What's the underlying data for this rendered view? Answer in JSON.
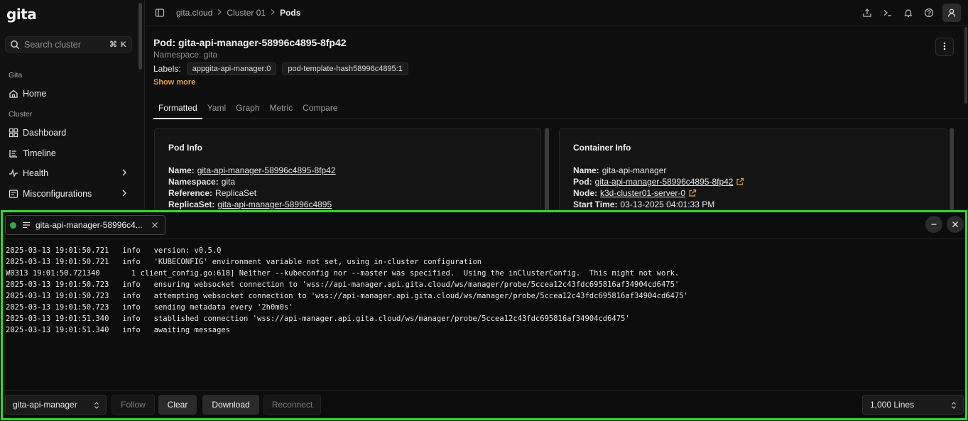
{
  "app": {
    "logo": "gita"
  },
  "sidebar": {
    "search_placeholder": "Search cluster",
    "search_shortcut": "⌘ K",
    "sections": [
      {
        "label": "Gita"
      },
      {
        "label": "Cluster"
      }
    ],
    "items": [
      {
        "label": "Home",
        "icon": "home-icon"
      },
      {
        "label": "Dashboard",
        "icon": "grid-icon"
      },
      {
        "label": "Timeline",
        "icon": "timeline-icon"
      },
      {
        "label": "Health",
        "icon": "pulse-icon"
      },
      {
        "label": "Misconfigurations",
        "icon": "config-icon"
      }
    ]
  },
  "breadcrumb": [
    "gita.cloud",
    "Cluster 01",
    "Pods"
  ],
  "pod": {
    "title": "Pod: gita-api-manager-58996c4895-8fp42",
    "namespace": "Namespace: gita",
    "labels_label": "Labels:",
    "labels": [
      "appgita-api-manager:0",
      "pod-template-hash58996c4895:1"
    ],
    "show_more": "Show more"
  },
  "tabs": [
    "Formatted",
    "Yaml",
    "Graph",
    "Metric",
    "Compare"
  ],
  "pod_info": {
    "title": "Pod Info",
    "rows": [
      {
        "k": "Name:",
        "v": "gita-api-manager-58996c4895-8fp42"
      },
      {
        "k": "Namespace:",
        "v": "gita"
      },
      {
        "k": "Reference:",
        "v": "ReplicaSet"
      },
      {
        "k": "ReplicaSet:",
        "v": "gita-api-manager-58996c4895"
      }
    ]
  },
  "container_info": {
    "title": "Container Info",
    "rows": [
      {
        "k": "Name:",
        "v": "gita-api-manager"
      },
      {
        "k": "Pod:",
        "v": "gita-api-manager-58996c4895-8fp42"
      },
      {
        "k": "Node:",
        "v": "k3d-cluster01-server-0"
      },
      {
        "k": "Start Time:",
        "v": "03-13-2025 04:01:33 PM"
      }
    ]
  },
  "logs": {
    "tab_title": "gita-api-manager-58996c4...",
    "lines": [
      "2025-03-13 19:01:50.721   info   version: v0.5.0",
      "2025-03-13 19:01:50.721   info   'KUBECONFIG' environment variable not set, using in-cluster configuration",
      "W0313 19:01:50.721340       1 client_config.go:618] Neither --kubeconfig nor --master was specified.  Using the inClusterConfig.  This might not work.",
      "2025-03-13 19:01:50.723   info   ensuring websocket connection to 'wss://api-manager.api.gita.cloud/ws/manager/probe/5ccea12c43fdc695816af34904cd6475'",
      "2025-03-13 19:01:50.723   info   attempting websocket connection to 'wss://api-manager.api.gita.cloud/ws/manager/probe/5ccea12c43fdc695816af34904cd6475'",
      "2025-03-13 19:01:50.723   info   sending metadata every '2h0m0s'",
      "2025-03-13 19:01:51.340   info   stablished connection 'wss://api-manager.api.gita.cloud/ws/manager/probe/5ccea12c43fdc695816af34904cd6475'",
      "2025-03-13 19:01:51.340   info   awaiting messages"
    ],
    "container_select": "gita-api-manager",
    "follow": "Follow",
    "clear": "Clear",
    "download": "Download",
    "reconnect": "Reconnect",
    "lines_select": "1,000 Lines"
  },
  "colors": {
    "accent": "#e2a03a",
    "highlight_border": "#22e022",
    "status_dot": "#27b34a"
  }
}
